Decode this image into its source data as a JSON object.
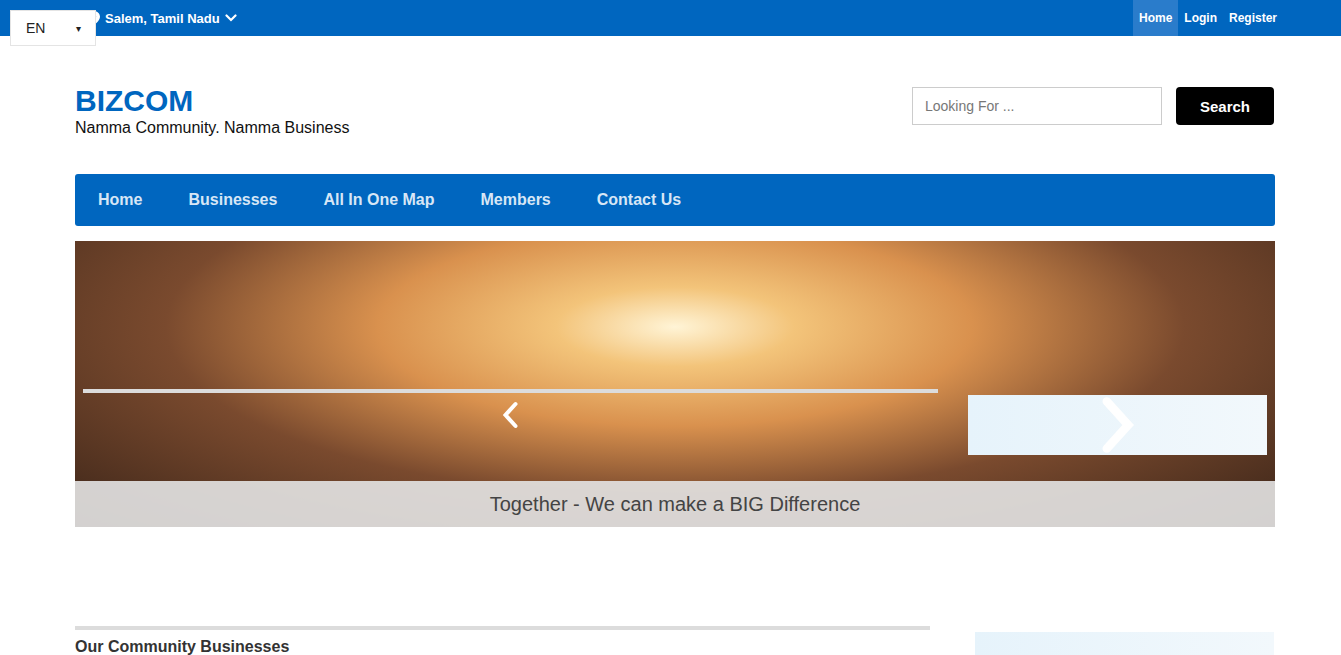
{
  "language_selector": {
    "value": "EN",
    "arrow": "▾"
  },
  "location": {
    "label": "Salem, Tamil Nadu"
  },
  "top_links": [
    {
      "label": "Home",
      "selected": true
    },
    {
      "label": "Login",
      "selected": false
    },
    {
      "label": "Register",
      "selected": false
    }
  ],
  "brand": {
    "name": "BIZCOM",
    "tagline": "Namma Community. Namma Business"
  },
  "search": {
    "placeholder": "Looking For ...",
    "button": "Search"
  },
  "nav": [
    {
      "label": "Home"
    },
    {
      "label": "Businesses"
    },
    {
      "label": "All In One Map"
    },
    {
      "label": "Members"
    },
    {
      "label": "Contact Us"
    }
  ],
  "slider": {
    "caption": "Together - We can make a BIG Difference"
  },
  "sections": {
    "businesses_title": "Our Community Businesses"
  }
}
